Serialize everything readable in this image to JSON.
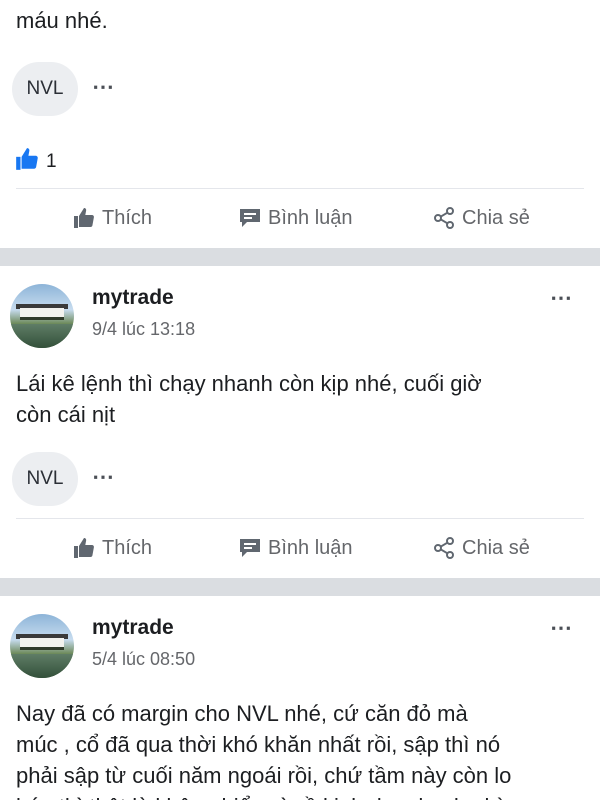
{
  "post0": {
    "text_tail": "máu nhé.",
    "tag": "NVL",
    "more_icon": "⋯",
    "reaction_count": "1"
  },
  "actions": {
    "like": "Thích",
    "comment": "Bình luận",
    "share": "Chia sẻ"
  },
  "post1": {
    "author": "mytrade",
    "timestamp": "9/4 lúc 13:18",
    "text_line1": "Lái kê lệnh thì chạy nhanh còn kịp nhé, cuối giờ",
    "text_line2": "còn cái nịt",
    "tag": "NVL",
    "more_icon": "⋯"
  },
  "post2": {
    "author": "mytrade",
    "timestamp": "5/4 lúc 08:50",
    "text_line1": "Nay đã có margin cho NVL nhé, cứ căn đỏ mà",
    "text_line2": "múc , cổ đã qua thời khó khăn nhất rồi, sập thì nó",
    "text_line3": "phải sập từ cuối năm ngoái rồi, chứ tầm này còn lo",
    "text_line4": "bán thì thật là không hiểu gì về kinh doanh, chu kỳ",
    "more_icon": "⋯"
  },
  "colors": {
    "separator": "#dadde1",
    "like_blue": "#1877f2",
    "secondary_text": "#65676b"
  }
}
